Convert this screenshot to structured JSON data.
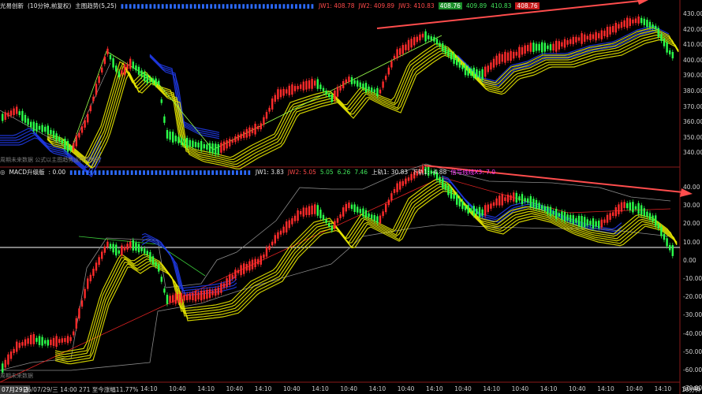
{
  "main_panel": {
    "title": "光易创新",
    "period_label": "(10分钟,前复权)",
    "indicator_label": "主图趋势(5,25)",
    "top_values": [
      {
        "text": "JW1: 408.78",
        "color": "red"
      },
      {
        "text": "JW2: 409.89",
        "color": "red"
      },
      {
        "text": "JW3: 410.83",
        "color": "red"
      },
      {
        "text": "408.76",
        "color": "chip-green"
      },
      {
        "text": "409.89",
        "color": "green"
      },
      {
        "text": "410.83",
        "color": "green"
      },
      {
        "text": "408.76",
        "color": "chip-red"
      }
    ],
    "note": "周期未来数据  公式以主图趋势运行得耗时",
    "y_labels": [
      "430.00",
      "420.00",
      "410.00",
      "400.00",
      "390.00",
      "380.00",
      "370.00",
      "360.00",
      "350.00",
      "340.00"
    ]
  },
  "macd_panel": {
    "title": "MACD升级版",
    "value_label": ": 0.00",
    "top_values": [
      {
        "text": "JW1: 3.83",
        "color": "white"
      },
      {
        "text": "JW2: 5.05",
        "color": "red"
      },
      {
        "text": "5.05",
        "color": "green"
      },
      {
        "text": "6.26",
        "color": "green"
      },
      {
        "text": "7.46",
        "color": "green"
      },
      {
        "text": "上轨1: 30.83",
        "color": "white"
      },
      {
        "text": "下轨1: -4.88",
        "color": "white"
      },
      {
        "text": "信号线线X3: 7.0",
        "color": "magenta"
      }
    ],
    "note": "周期未来数据",
    "y_labels": [
      "40.00",
      "30.00",
      "20.00",
      "10.00",
      "0.00",
      "-10.00",
      "-20.00",
      "-30.00",
      "-40.00",
      "-50.00",
      "-60.00",
      "-70.00"
    ]
  },
  "time_axis": {
    "date_label": "07月29日",
    "info": "26/07/29/三 14:00 271  至今涨幅11.77%",
    "ticks": [
      "14:10",
      "10:40",
      "14:10",
      "10:40",
      "14:10",
      "10:40",
      "14:10",
      "10:40",
      "14:10",
      "10:40",
      "14:10",
      "10:40",
      "14:10",
      "10:40",
      "14:10",
      "10:40",
      "14:10",
      "10:40",
      "14:10",
      "10:40"
    ],
    "period_button": "10分钟"
  },
  "colors": {
    "up": "#ff2b2b",
    "down": "#2bff4a",
    "ribbon_yellow": "#e6e600",
    "ribbon_blue": "#1f3ae6",
    "arrow": "#ff4d4d",
    "zero_line": "#ffffff",
    "grid_border": "#8a8a8a"
  },
  "icons": {
    "arrow_main": "arrow-right-icon",
    "arrow_macd": "arrow-right-icon"
  }
}
